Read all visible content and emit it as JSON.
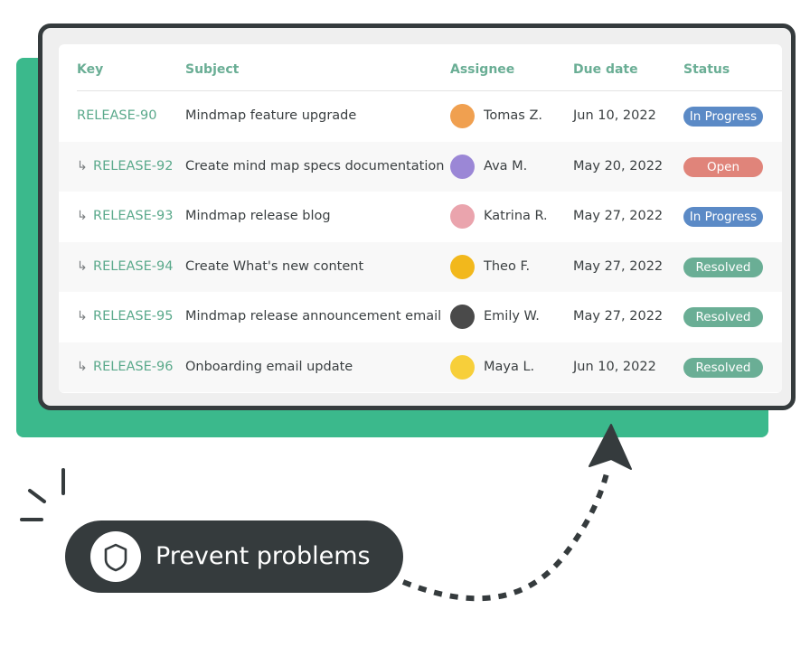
{
  "table": {
    "columns": {
      "key": "Key",
      "subject": "Subject",
      "assignee": "Assignee",
      "due_date": "Due date",
      "status": "Status"
    },
    "rows": [
      {
        "key": "RELEASE-90",
        "subtask": false,
        "subject": "Mindmap feature upgrade",
        "assignee": "Tomas Z.",
        "avatar_color": "#f0a050",
        "due_date": "Jun 10, 2022",
        "status": "In Progress"
      },
      {
        "key": "RELEASE-92",
        "subtask": true,
        "subject": "Create mind map specs documentation",
        "assignee": "Ava M.",
        "avatar_color": "#9b87d6",
        "due_date": "May 20, 2022",
        "status": "Open"
      },
      {
        "key": "RELEASE-93",
        "subtask": true,
        "subject": "Mindmap release blog",
        "assignee": "Katrina R.",
        "avatar_color": "#eaa4ad",
        "due_date": "May 27, 2022",
        "status": "In Progress"
      },
      {
        "key": "RELEASE-94",
        "subtask": true,
        "subject": "Create What's new content",
        "assignee": "Theo F.",
        "avatar_color": "#f2b81c",
        "due_date": "May 27, 2022",
        "status": "Resolved"
      },
      {
        "key": "RELEASE-95",
        "subtask": true,
        "subject": "Mindmap release announcement email",
        "assignee": "Emily W.",
        "avatar_color": "#4a4a4a",
        "due_date": "May 27, 2022",
        "status": "Resolved"
      },
      {
        "key": "RELEASE-96",
        "subtask": true,
        "subject": "Onboarding email update",
        "assignee": "Maya L.",
        "avatar_color": "#f7cf3a",
        "due_date": "Jun 10, 2022",
        "status": "Resolved"
      }
    ],
    "subtask_icon": "subtask-arrow-icon",
    "subtask_glyph": "↳"
  },
  "status_colors": {
    "In Progress": "#5b8ac6",
    "Open": "#e0847a",
    "Resolved": "#6aae95"
  },
  "callout": {
    "icon": "shield-icon",
    "label": "Prevent problems"
  },
  "colors": {
    "accent_green": "#3bb98c",
    "frame_dark": "#353b3d",
    "header_text": "#6aae95"
  }
}
